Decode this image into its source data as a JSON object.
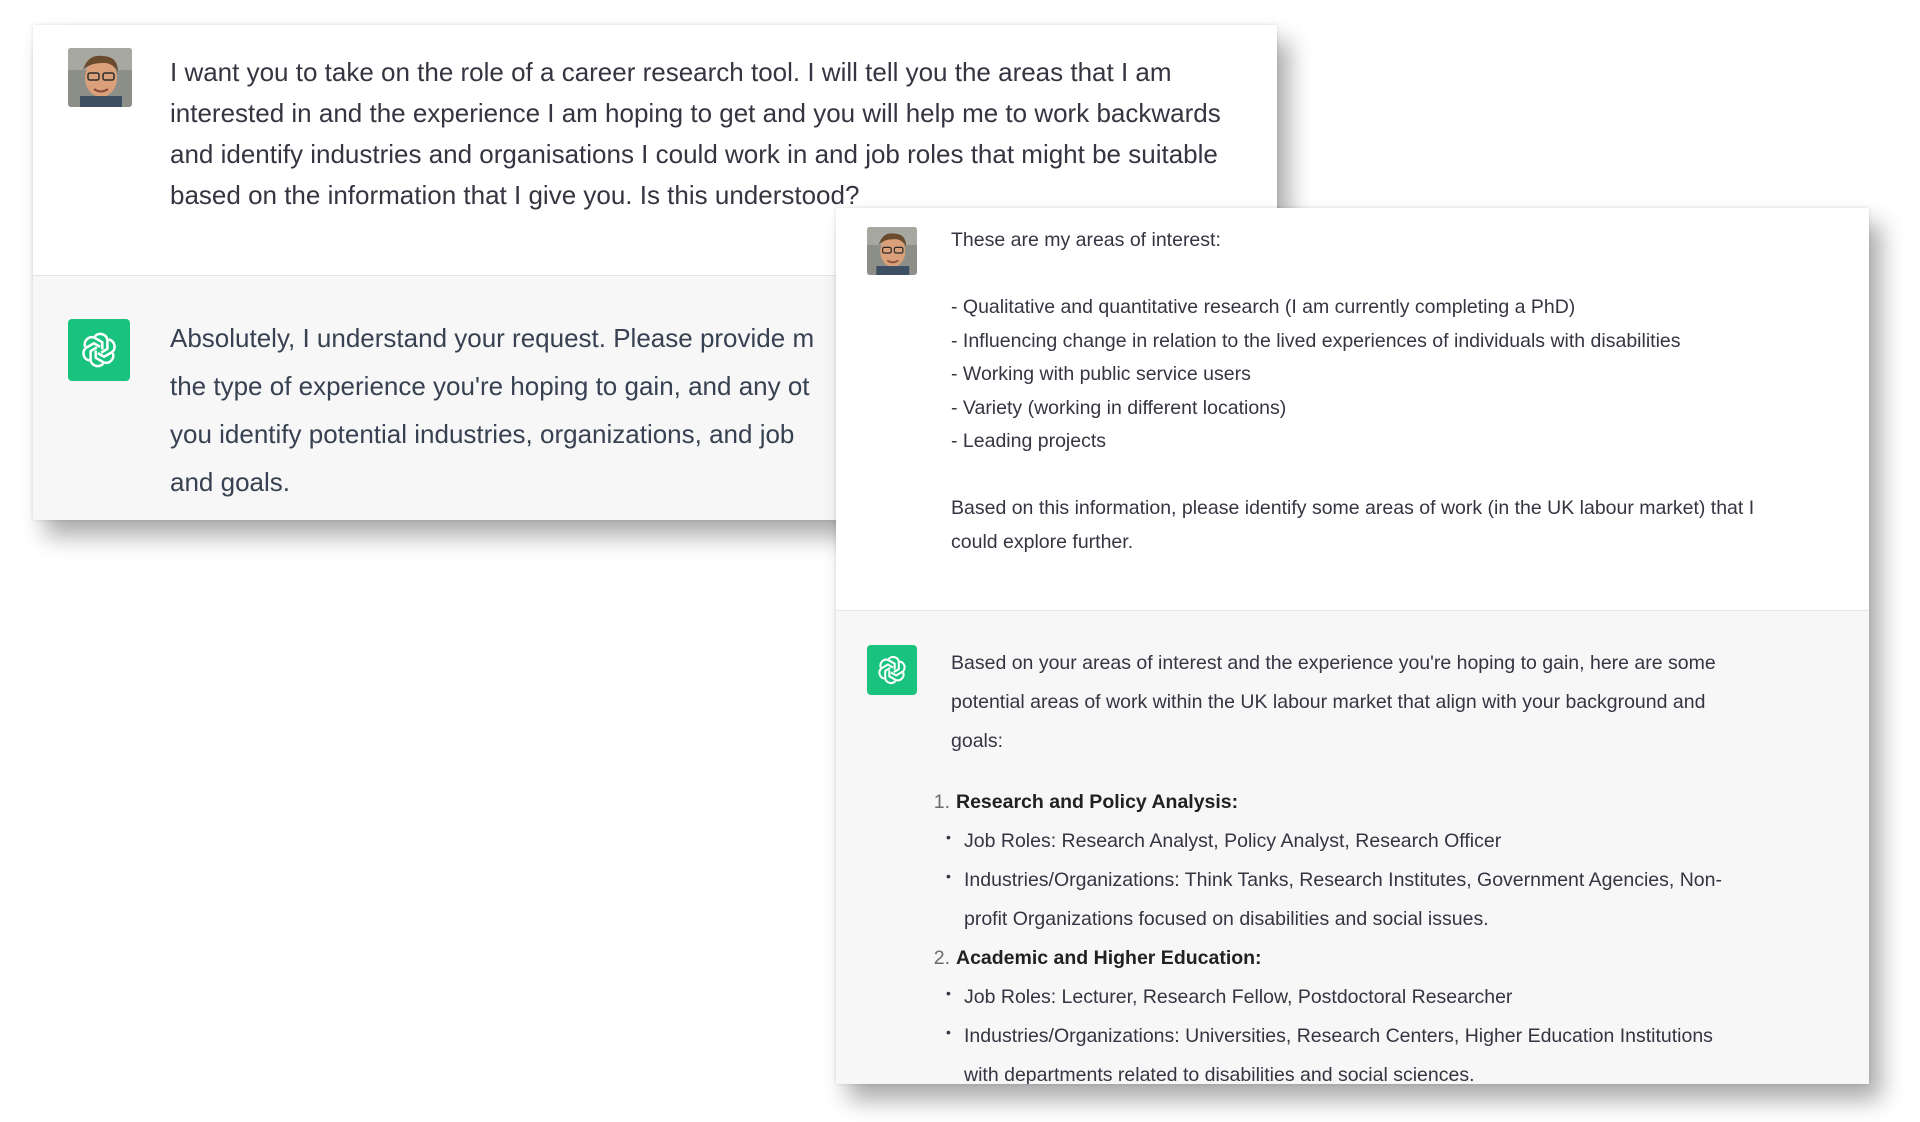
{
  "panel_a": {
    "user_message": "I want you to take on the role of a career research tool. I will tell you the areas that I am\ninterested in and the experience I am hoping to get and you will help me to work backwards\nand identify industries and organisations I could work in and job roles that might be suitable\nbased on the information that I give you. Is this understood?",
    "assistant_message": "Absolutely, I understand your request. Please provide m\nthe type of experience you're hoping to gain, and any ot\nyou identify potential industries, organizations, and job\nand goals."
  },
  "panel_b": {
    "user_message": {
      "intro": "These are my areas of interest:",
      "interests": [
        "- Qualitative and quantitative research (I am currently completing a PhD)",
        "- Influencing change in relation to the lived experiences of individuals with disabilities",
        "- Working with public service users",
        "- Variety (working in different locations)",
        "- Leading projects"
      ],
      "request_line1": "Based on this information, please identify some areas of work (in the UK labour market) that I",
      "request_line2": "could explore further."
    },
    "assistant_message": {
      "intro_line1": "Based on your areas of interest and the experience you're hoping to gain, here are some",
      "intro_line2": "potential areas of work within the UK labour market that align with your background and",
      "intro_line3": "goals:",
      "items": [
        {
          "number": "1.",
          "title": "Research and Policy Analysis:",
          "job_roles": "Job Roles: Research Analyst, Policy Analyst, Research Officer",
          "industries_line1": "Industries/Organizations: Think Tanks, Research Institutes, Government Agencies, Non-",
          "industries_line2": "profit Organizations focused on disabilities and social issues."
        },
        {
          "number": "2.",
          "title": "Academic and Higher Education:",
          "job_roles": "Job Roles: Lecturer, Research Fellow, Postdoctoral Researcher",
          "industries_line1": "Industries/Organizations: Universities, Research Centers, Higher Education Institutions",
          "industries_line2": "with departments related to disabilities and social sciences."
        }
      ]
    }
  },
  "icons": {
    "user_avatar": "user-avatar",
    "assistant_logo": "openai-logo-icon"
  },
  "colors": {
    "assistant_logo_bg": "#19c37d",
    "assistant_row_bg": "#f7f7f8",
    "text": "#343541"
  }
}
